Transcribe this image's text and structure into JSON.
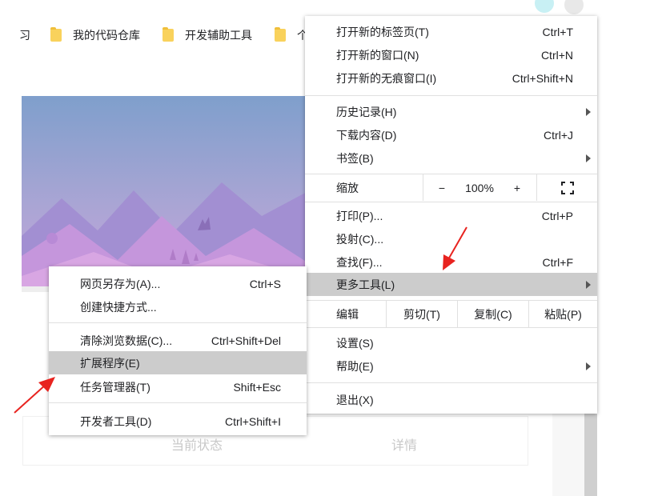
{
  "bookmarks": {
    "items": [
      {
        "label": "习"
      },
      {
        "label": "我的代码仓库"
      },
      {
        "label": "开发辅助工具"
      },
      {
        "label": "个"
      }
    ]
  },
  "page": {
    "columns": [
      "当前状态",
      "详情"
    ]
  },
  "main_menu": {
    "new_tab": {
      "label": "打开新的标签页(T)",
      "shortcut": "Ctrl+T"
    },
    "new_window": {
      "label": "打开新的窗口(N)",
      "shortcut": "Ctrl+N"
    },
    "incognito": {
      "label": "打开新的无痕窗口(I)",
      "shortcut": "Ctrl+Shift+N"
    },
    "history": {
      "label": "历史记录(H)"
    },
    "downloads": {
      "label": "下载内容(D)",
      "shortcut": "Ctrl+J"
    },
    "bookmarks": {
      "label": "书签(B)"
    },
    "zoom": {
      "label": "缩放",
      "minus": "−",
      "value": "100%",
      "plus": "+",
      "fullscreen_icon": "fullscreen-icon"
    },
    "print": {
      "label": "打印(P)...",
      "shortcut": "Ctrl+P"
    },
    "cast": {
      "label": "投射(C)..."
    },
    "find": {
      "label": "查找(F)...",
      "shortcut": "Ctrl+F"
    },
    "more_tools": {
      "label": "更多工具(L)"
    },
    "edit": {
      "label": "编辑",
      "cut": "剪切(T)",
      "copy": "复制(C)",
      "paste": "粘贴(P)"
    },
    "settings": {
      "label": "设置(S)"
    },
    "help": {
      "label": "帮助(E)"
    },
    "exit": {
      "label": "退出(X)"
    }
  },
  "sub_menu": {
    "save_as": {
      "label": "网页另存为(A)...",
      "shortcut": "Ctrl+S"
    },
    "shortcut": {
      "label": "创建快捷方式..."
    },
    "clear_data": {
      "label": "清除浏览数据(C)...",
      "shortcut": "Ctrl+Shift+Del"
    },
    "extensions": {
      "label": "扩展程序(E)"
    },
    "task_manager": {
      "label": "任务管理器(T)",
      "shortcut": "Shift+Esc"
    },
    "dev_tools": {
      "label": "开发者工具(D)",
      "shortcut": "Ctrl+Shift+I"
    }
  },
  "colors": {
    "highlight": "#cccccc",
    "annotation_arrow": "#e8231f",
    "folder": "#f9d25c"
  }
}
